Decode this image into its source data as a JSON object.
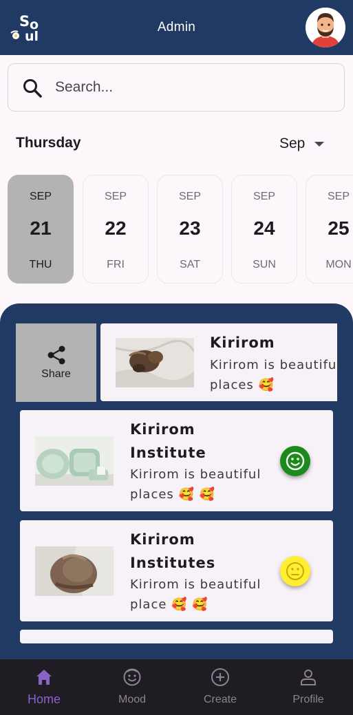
{
  "app_bar": {
    "title": "Admin",
    "logo_icon": "soul-logo-icon",
    "avatar_icon": "user-avatar-icon",
    "color": "#213a63"
  },
  "search": {
    "placeholder": "Search...",
    "value": ""
  },
  "calendar": {
    "day_label": "Thursday",
    "month_select": "Sep",
    "dates": [
      {
        "month": "SEP",
        "day": "21",
        "weekday": "THU",
        "selected": true
      },
      {
        "month": "SEP",
        "day": "22",
        "weekday": "FRI",
        "selected": false
      },
      {
        "month": "SEP",
        "day": "23",
        "weekday": "SAT",
        "selected": false
      },
      {
        "month": "SEP",
        "day": "24",
        "weekday": "SUN",
        "selected": false
      },
      {
        "month": "SEP",
        "day": "25",
        "weekday": "MON",
        "selected": false
      }
    ]
  },
  "feed": {
    "share_action": {
      "label": "Share",
      "icon": "share-icon"
    },
    "posts": [
      {
        "title_lines": [
          "Kirirom"
        ],
        "body_lines": [
          "Kirirom is beautiful",
          "places 🥰"
        ],
        "thumb": "cat-on-bed-photo",
        "mood": null
      },
      {
        "title_lines": [
          "Kirirom",
          "Institute"
        ],
        "body_lines": [
          "Kirirom is beautiful",
          "places 🥰 🥰"
        ],
        "thumb": "green-dishes-photo",
        "mood": {
          "icon": "happy-face-icon",
          "color": "#1a8a1a"
        }
      },
      {
        "title_lines": [
          "Kirirom",
          "Institutes"
        ],
        "body_lines": [
          "Kirirom is beautiful",
          "place 🥰 🥰"
        ],
        "thumb": "cat-closeup-photo",
        "mood": {
          "icon": "neutral-face-icon",
          "color": "#ffee33"
        }
      }
    ]
  },
  "bottom_nav": {
    "items": [
      {
        "label": "Home",
        "icon": "home-icon",
        "active": true
      },
      {
        "label": "Mood",
        "icon": "mood-face-icon",
        "active": false
      },
      {
        "label": "Create",
        "icon": "add-circle-icon",
        "active": false
      },
      {
        "label": "Profile",
        "icon": "profile-icon",
        "active": false
      }
    ],
    "active_color": "#8a63c9"
  }
}
